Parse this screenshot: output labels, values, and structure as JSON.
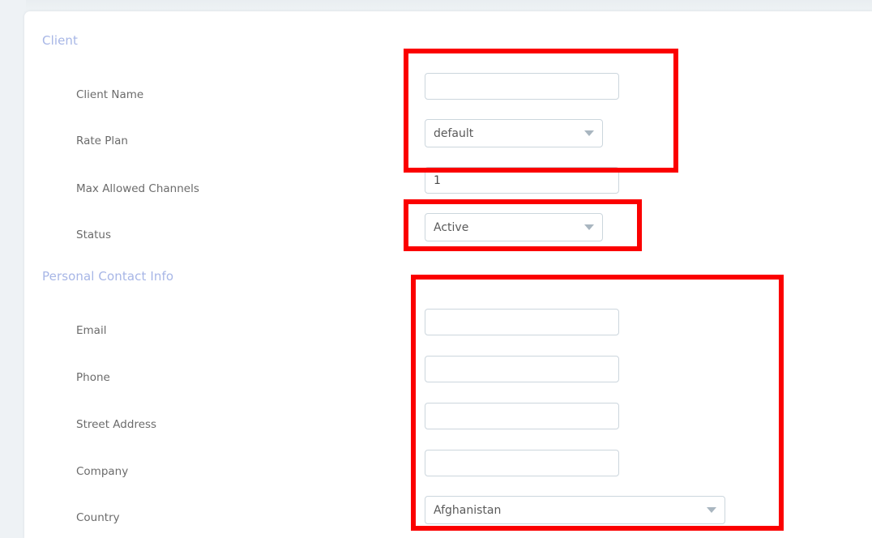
{
  "sections": [
    {
      "heading": "Client",
      "fields": [
        {
          "label": "Client Name",
          "type": "text",
          "value": "",
          "placeholder": ""
        },
        {
          "label": "Rate Plan",
          "type": "select",
          "value": "default"
        },
        {
          "label": "Max Allowed Channels",
          "type": "text",
          "value": "1",
          "placeholder": ""
        },
        {
          "label": "Status",
          "type": "select",
          "value": "Active"
        }
      ]
    },
    {
      "heading": "Personal Contact Info",
      "fields": [
        {
          "label": "Email",
          "type": "text",
          "value": "",
          "placeholder": ""
        },
        {
          "label": "Phone",
          "type": "text",
          "value": "",
          "placeholder": ""
        },
        {
          "label": "Street Address",
          "type": "text",
          "value": "",
          "placeholder": ""
        },
        {
          "label": "Company",
          "type": "text",
          "value": "",
          "placeholder": ""
        },
        {
          "label": "Country",
          "type": "select",
          "value": "Afghanistan"
        }
      ]
    }
  ],
  "icons": {
    "dropdown_arrow": "chevron-down-icon"
  },
  "annotations": {
    "color": "#fb0000",
    "boxes": [
      {
        "name": "highlight-client-name-and-rate-plan"
      },
      {
        "name": "highlight-status"
      },
      {
        "name": "highlight-personal-contact-info"
      }
    ]
  },
  "colors": {
    "background": "#eef2f5",
    "card": "#ffffff",
    "section_heading": "#a7b6e6",
    "label": "#6b6b6b",
    "input_border": "#ccd6dd",
    "annotation": "#fb0000"
  }
}
